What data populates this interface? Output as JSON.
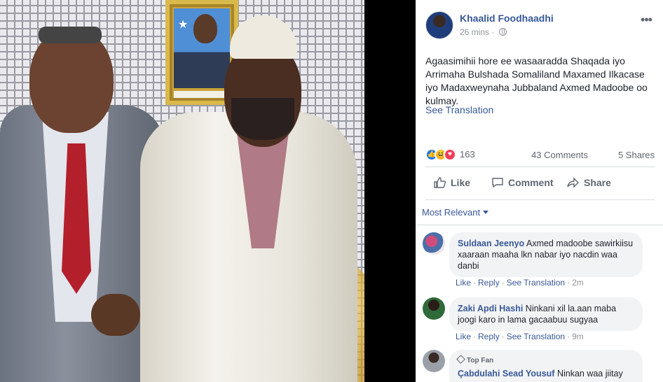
{
  "post": {
    "author": "Khaalid Foodhaadhi",
    "time": "26 mins",
    "privacy_icon": "globe-icon",
    "text": "Agaasimihii hore ee wasaaradda Shaqada iyo Arrimaha Bulshada Somaliland Maxamed Ilkacase iyo Madaxweynaha Jubbaland Axmed Madoobe oo kulmay.",
    "see_translation": "See Translation"
  },
  "reactions": {
    "count": "163",
    "types": [
      "like-icon",
      "haha-icon",
      "love-icon"
    ],
    "comments": "43 Comments",
    "shares": "5 Shares"
  },
  "actions": {
    "like": "Like",
    "comment": "Comment",
    "share": "Share"
  },
  "sort": {
    "label": "Most Relevant"
  },
  "comments": [
    {
      "name": "Suldaan Jeenyo",
      "text": "Axmed madoobe sawirkiisu xaaraan maaha lkn nabar iyo nacdin waa danbi",
      "like": "Like",
      "reply": "Reply",
      "translate": "See Translation",
      "time": "2m"
    },
    {
      "name": "Zaki Apdi Hashi",
      "text": "Ninkani xil la.aan maba joogi karo in lama gacaabuu sugyaa",
      "like": "Like",
      "reply": "Reply",
      "translate": "See Translation",
      "time": "9m"
    },
    {
      "badge": "Top Fan",
      "name": "Çabdulahi Sead Yousuf",
      "text": "Ninkan waa jiitay"
    }
  ],
  "colors": {
    "link": "#385898",
    "meta": "#90949c",
    "bubble": "#f2f3f5"
  }
}
